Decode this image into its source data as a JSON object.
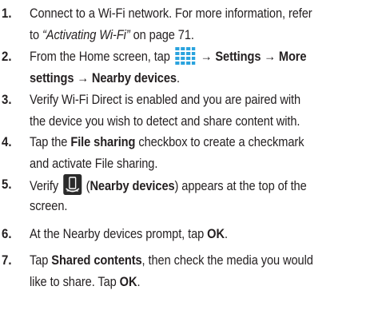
{
  "steps": [
    {
      "number": "1.",
      "line1": "Connect to a Wi-Fi network. For more information, refer",
      "line2_prefix": "to ",
      "line2_ref": "“Activating Wi-Fi”",
      "line2_suffix": " on page 71."
    },
    {
      "number": "2.",
      "line1_prefix": "From the Home screen, tap ",
      "apps_icon": "apps-grid-icon",
      "line1_arrow1": " → ",
      "settings": "Settings",
      "line1_arrow2": " → ",
      "more_settings_a": "More",
      "more_settings_b": "settings",
      "line2_arrow": " → ",
      "nearby_devices": "Nearby devices",
      "line2_suffix": "."
    },
    {
      "number": "3.",
      "line1": "Verify Wi-Fi Direct is enabled and you are paired with",
      "line2": "the device you wish to detect and share content with."
    },
    {
      "number": "4.",
      "line1_prefix": "Tap the ",
      "file_sharing": "File sharing",
      "line1_suffix": " checkbox to create a checkmark",
      "line2": "and activate File sharing."
    },
    {
      "number": "5.",
      "line1_prefix": "Verify ",
      "nearby_icon": "nearby-devices-icon",
      "line1_open": " (",
      "nearby_devices": "Nearby devices",
      "line1_suffix": ") appears at the top of the",
      "line2": "screen."
    },
    {
      "number": "6.",
      "line1_prefix": "At the Nearby devices prompt, tap ",
      "ok": "OK",
      "line1_suffix": "."
    },
    {
      "number": "7.",
      "line1_prefix": "Tap ",
      "shared_contents": "Shared contents",
      "line1_suffix": ", then check the media you would",
      "line2_prefix": "like to share. Tap ",
      "ok": "OK",
      "line2_suffix": "."
    }
  ],
  "colors": {
    "text": "#231f20",
    "icon_blue": "#2aa3de",
    "icon_dark": "#2b2b2b"
  }
}
